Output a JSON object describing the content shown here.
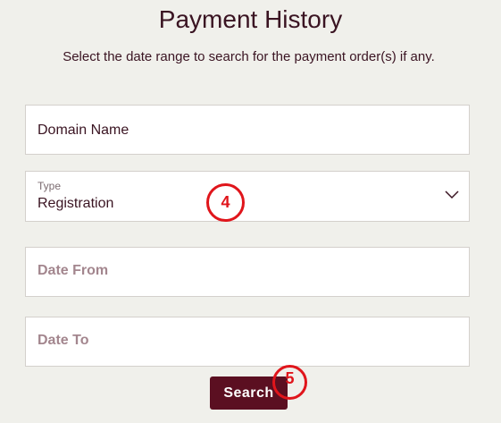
{
  "header": {
    "title": "Payment History",
    "subtitle": "Select the date range to search for the payment order(s) if any."
  },
  "form": {
    "domain_name_label": "Domain Name",
    "type": {
      "label": "Type",
      "selected_value": "Registration"
    },
    "date_from_placeholder": "Date From",
    "date_to_placeholder": "Date To",
    "search_label": "Search"
  },
  "annotations": {
    "marker_4": "4",
    "marker_5": "5"
  },
  "colors": {
    "background": "#f0f0eb",
    "text": "#3a1422",
    "button": "#5b0f21",
    "placeholder": "#a3868e",
    "marker": "#e0151b"
  },
  "icons": {
    "type_dropdown": "chevron-down-icon"
  }
}
